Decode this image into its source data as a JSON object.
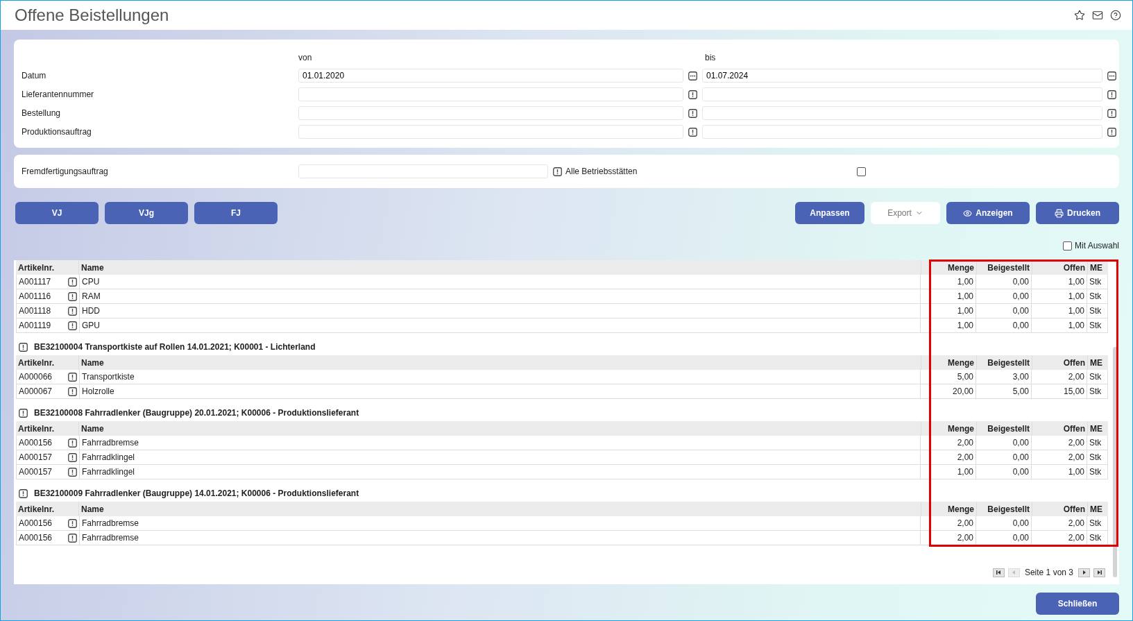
{
  "window": {
    "title": "Offene Beistellungen"
  },
  "header_icons": [
    {
      "kind": "star"
    },
    {
      "kind": "mail"
    },
    {
      "kind": "help"
    }
  ],
  "filter": {
    "col_von": "von",
    "col_bis": "bis",
    "rows": [
      {
        "label": "Datum",
        "from": {
          "value": "01.01.2020",
          "kind": "ellipsis"
        },
        "to": {
          "value": "01.07.2024",
          "kind": "ellipsis"
        }
      },
      {
        "label": "Lieferantennummer",
        "from": {
          "kind": "info"
        },
        "to": {
          "kind": "info"
        }
      },
      {
        "label": "Bestellung",
        "from": {
          "kind": "info"
        },
        "to": {
          "kind": "info"
        }
      },
      {
        "label": "Produktionsauftrag",
        "from": {
          "kind": "info"
        },
        "to": {
          "kind": "info"
        }
      }
    ]
  },
  "extra": {
    "label": "Fremdfertigungsauftrag",
    "field": {
      "kind": "info"
    },
    "checkbox": {
      "label": "Alle Betriebsstätten",
      "checked": false
    }
  },
  "left_buttons": [
    "VJ",
    "VJg",
    "FJ"
  ],
  "right_buttons": [
    {
      "label": "Anpassen",
      "kind": "primary"
    },
    {
      "label": "Export",
      "kind": "dropdown"
    },
    {
      "label": "Anzeigen",
      "kind": "view"
    },
    {
      "label": "Drucken",
      "kind": "print"
    }
  ],
  "mit_auswahl": {
    "label": "Mit Auswahl",
    "checked": false
  },
  "groups": [
    {
      "columns": [
        "Artikelnr.",
        "Name",
        "Menge",
        "Beigestellt",
        "Offen",
        "ME"
      ],
      "rows": [
        [
          "A001117",
          "CPU",
          "1,00",
          "0,00",
          "1,00",
          "Stk"
        ],
        [
          "A001116",
          "RAM",
          "1,00",
          "0,00",
          "1,00",
          "Stk"
        ],
        [
          "A001118",
          "HDD",
          "1,00",
          "0,00",
          "1,00",
          "Stk"
        ],
        [
          "A001119",
          "GPU",
          "1,00",
          "0,00",
          "1,00",
          "Stk"
        ]
      ]
    },
    {
      "title": "BE32100004 Transportkiste auf Rollen 14.01.2021; K00001 - Lichterland",
      "columns": [
        "Artikelnr.",
        "Name",
        "Menge",
        "Beigestellt",
        "Offen",
        "ME"
      ],
      "rows": [
        [
          "A000066",
          "Transportkiste",
          "5,00",
          "3,00",
          "2,00",
          "Stk"
        ],
        [
          "A000067",
          "Holzrolle",
          "20,00",
          "5,00",
          "15,00",
          "Stk"
        ]
      ]
    },
    {
      "title": "BE32100008 Fahrradlenker (Baugruppe) 20.01.2021; K00006 - Produktionslieferant",
      "columns": [
        "Artikelnr.",
        "Name",
        "Menge",
        "Beigestellt",
        "Offen",
        "ME"
      ],
      "rows": [
        [
          "A000156",
          "Fahrradbremse",
          "2,00",
          "0,00",
          "2,00",
          "Stk"
        ],
        [
          "A000157",
          "Fahrradklingel",
          "2,00",
          "0,00",
          "2,00",
          "Stk"
        ],
        [
          "A000157",
          "Fahrradklingel",
          "1,00",
          "0,00",
          "1,00",
          "Stk"
        ]
      ]
    },
    {
      "title": "BE32100009 Fahrradlenker (Baugruppe) 14.01.2021; K00006 - Produktionslieferant",
      "columns": [
        "Artikelnr.",
        "Name",
        "Menge",
        "Beigestellt",
        "Offen",
        "ME"
      ],
      "rows": [
        [
          "A000156",
          "Fahrradbremse",
          "2,00",
          "0,00",
          "2,00",
          "Stk"
        ],
        [
          "A000156",
          "Fahrradbremse",
          "2,00",
          "0,00",
          "2,00",
          "Stk"
        ]
      ]
    }
  ],
  "pager": {
    "text": "Seite 1 von 3",
    "buttons": [
      {
        "kind": "first",
        "disabled": false
      },
      {
        "kind": "prev",
        "disabled": true
      },
      {
        "kind": "next",
        "disabled": false
      },
      {
        "kind": "last",
        "disabled": false
      }
    ]
  },
  "close_button": "Schließen"
}
